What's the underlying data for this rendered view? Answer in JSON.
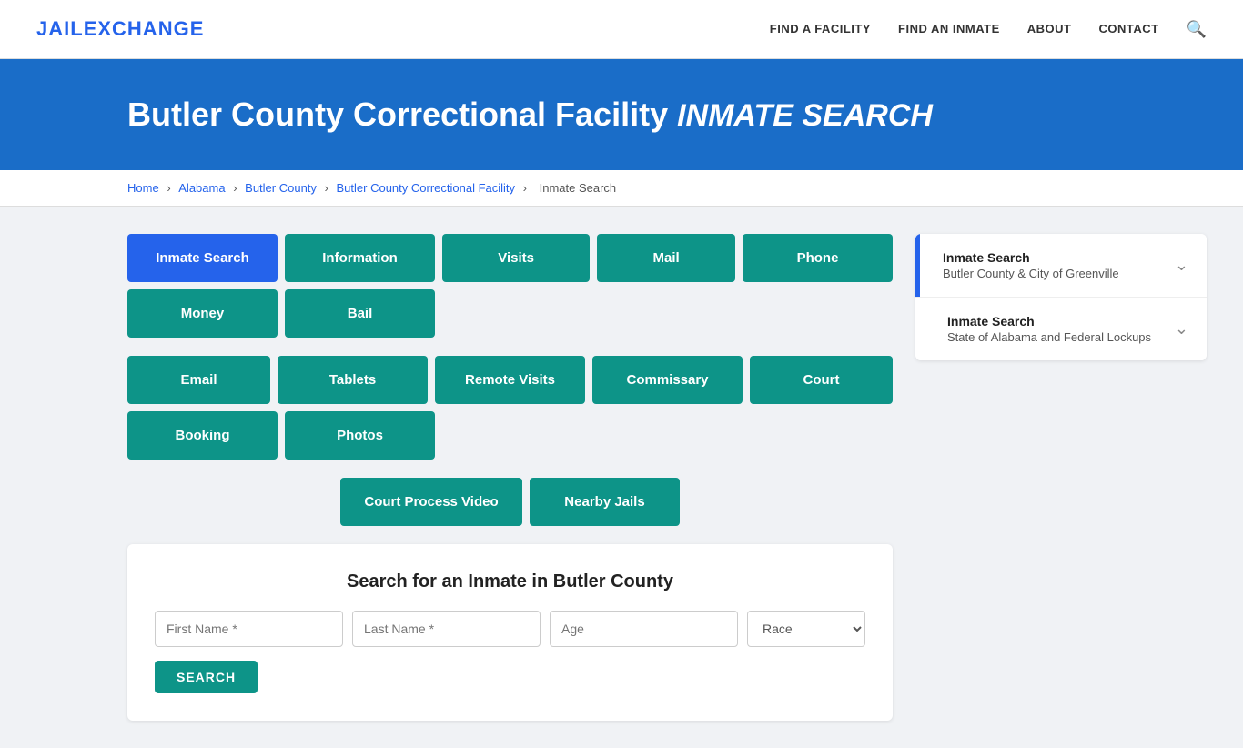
{
  "logo": {
    "prefix": "JAIL",
    "suffix": "EXCHANGE"
  },
  "navbar": {
    "links": [
      {
        "id": "find-facility",
        "label": "FIND A FACILITY"
      },
      {
        "id": "find-inmate",
        "label": "FIND AN INMATE"
      },
      {
        "id": "about",
        "label": "ABOUT"
      },
      {
        "id": "contact",
        "label": "CONTACT"
      }
    ]
  },
  "hero": {
    "title_main": "Butler County Correctional Facility",
    "title_em": "INMATE SEARCH"
  },
  "breadcrumb": {
    "items": [
      {
        "id": "home",
        "label": "Home",
        "link": true
      },
      {
        "id": "alabama",
        "label": "Alabama",
        "link": true
      },
      {
        "id": "butler-county",
        "label": "Butler County",
        "link": true
      },
      {
        "id": "facility",
        "label": "Butler County Correctional Facility",
        "link": true
      },
      {
        "id": "inmate-search",
        "label": "Inmate Search",
        "link": false
      }
    ]
  },
  "nav_buttons": {
    "row1": [
      {
        "id": "inmate-search",
        "label": "Inmate Search",
        "active": true
      },
      {
        "id": "information",
        "label": "Information",
        "active": false
      },
      {
        "id": "visits",
        "label": "Visits",
        "active": false
      },
      {
        "id": "mail",
        "label": "Mail",
        "active": false
      },
      {
        "id": "phone",
        "label": "Phone",
        "active": false
      },
      {
        "id": "money",
        "label": "Money",
        "active": false
      },
      {
        "id": "bail",
        "label": "Bail",
        "active": false
      }
    ],
    "row2": [
      {
        "id": "email",
        "label": "Email",
        "active": false
      },
      {
        "id": "tablets",
        "label": "Tablets",
        "active": false
      },
      {
        "id": "remote-visits",
        "label": "Remote Visits",
        "active": false
      },
      {
        "id": "commissary",
        "label": "Commissary",
        "active": false
      },
      {
        "id": "court",
        "label": "Court",
        "active": false
      },
      {
        "id": "booking",
        "label": "Booking",
        "active": false
      },
      {
        "id": "photos",
        "label": "Photos",
        "active": false
      }
    ],
    "row3": [
      {
        "id": "court-process-video",
        "label": "Court Process Video",
        "active": false
      },
      {
        "id": "nearby-jails",
        "label": "Nearby Jails",
        "active": false
      }
    ]
  },
  "search_form": {
    "title": "Search for an Inmate in Butler County",
    "first_name_placeholder": "First Name *",
    "last_name_placeholder": "Last Name *",
    "age_placeholder": "Age",
    "race_placeholder": "Race",
    "search_button": "SEARCH"
  },
  "sidebar": {
    "items": [
      {
        "id": "butler-county-search",
        "title": "Inmate Search",
        "subtitle": "Butler County & City of Greenville",
        "has_blue_bar": true
      },
      {
        "id": "alabama-search",
        "title": "Inmate Search",
        "subtitle": "State of Alabama and Federal Lockups",
        "has_blue_bar": false
      }
    ]
  }
}
